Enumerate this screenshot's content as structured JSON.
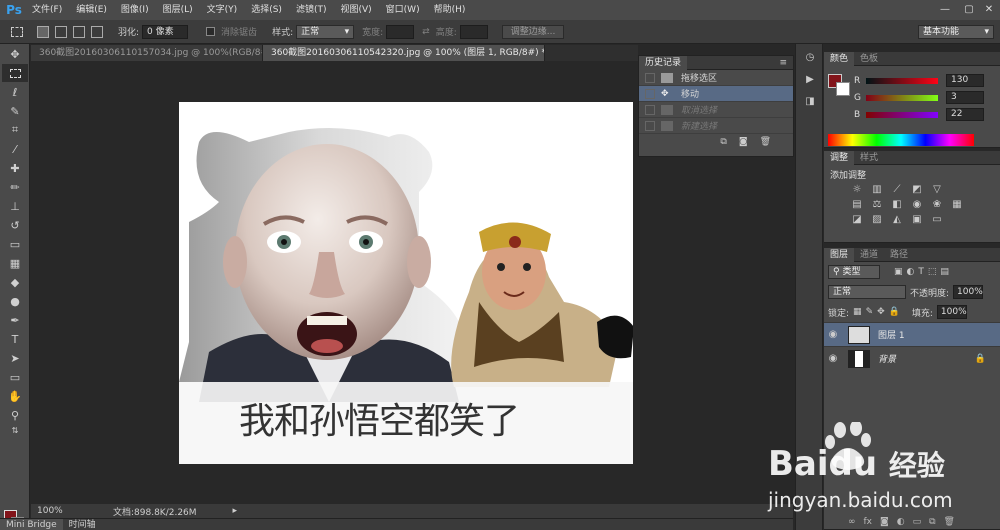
{
  "app": {
    "logo": "Ps"
  },
  "menubar": {
    "items": [
      "文件(F)",
      "编辑(E)",
      "图像(I)",
      "图层(L)",
      "文字(Y)",
      "选择(S)",
      "滤镜(T)",
      "视图(V)",
      "窗口(W)",
      "帮助(H)"
    ],
    "window_controls": [
      "—",
      "▢",
      "✕"
    ]
  },
  "options": {
    "feather_label": "羽化:",
    "feather_value": "0 像素",
    "antialias_label": "消除锯齿",
    "style_label": "样式:",
    "style_value": "正常",
    "width_label": "宽度:",
    "height_label": "高度:",
    "refine_edge": "调整边缘...",
    "workspace": "基本功能"
  },
  "tabs": [
    {
      "label": "360截图20160306110157034.jpg @ 100%(RGB/8#) *",
      "close": "×"
    },
    {
      "label": "360截图20160306110542320.jpg @ 100% (图层 1, RGB/8#) *",
      "close": "×"
    }
  ],
  "canvas": {
    "caption": "我和孙悟空都笑了"
  },
  "status": {
    "zoom": "100%",
    "doc": "文档:898.8K/2.26M"
  },
  "bottom_tabs": [
    "Mini Bridge",
    "时间轴"
  ],
  "history": {
    "tab": "历史记录",
    "rows": [
      {
        "label": "拖移选区",
        "state": "normal"
      },
      {
        "label": "移动",
        "state": "selected"
      },
      {
        "label": "取消选择",
        "state": "dimmed"
      },
      {
        "label": "新建选择",
        "state": "dimmed"
      }
    ]
  },
  "color_panel": {
    "tabs": [
      "颜色",
      "色板"
    ],
    "r_label": "R",
    "g_label": "G",
    "b_label": "B",
    "r": "130",
    "g": "3",
    "b": "22",
    "fg_color": "#82141a"
  },
  "adjust_panel": {
    "tabs": [
      "调整",
      "样式"
    ],
    "title": "添加调整"
  },
  "layers_panel": {
    "tabs": [
      "图层",
      "通道",
      "路径"
    ],
    "kind_label": "类型",
    "blend_mode": "正常",
    "opacity_label": "不透明度:",
    "opacity_value": "100%",
    "lock_label": "锁定:",
    "fill_label": "填充:",
    "fill_value": "100%",
    "layers": [
      {
        "name": "图层 1",
        "selected": true
      },
      {
        "name": "背景",
        "selected": false
      }
    ]
  },
  "watermark": {
    "brand": "Bai",
    "brand2": "经验",
    "url": "jingyan.baidu.com"
  }
}
